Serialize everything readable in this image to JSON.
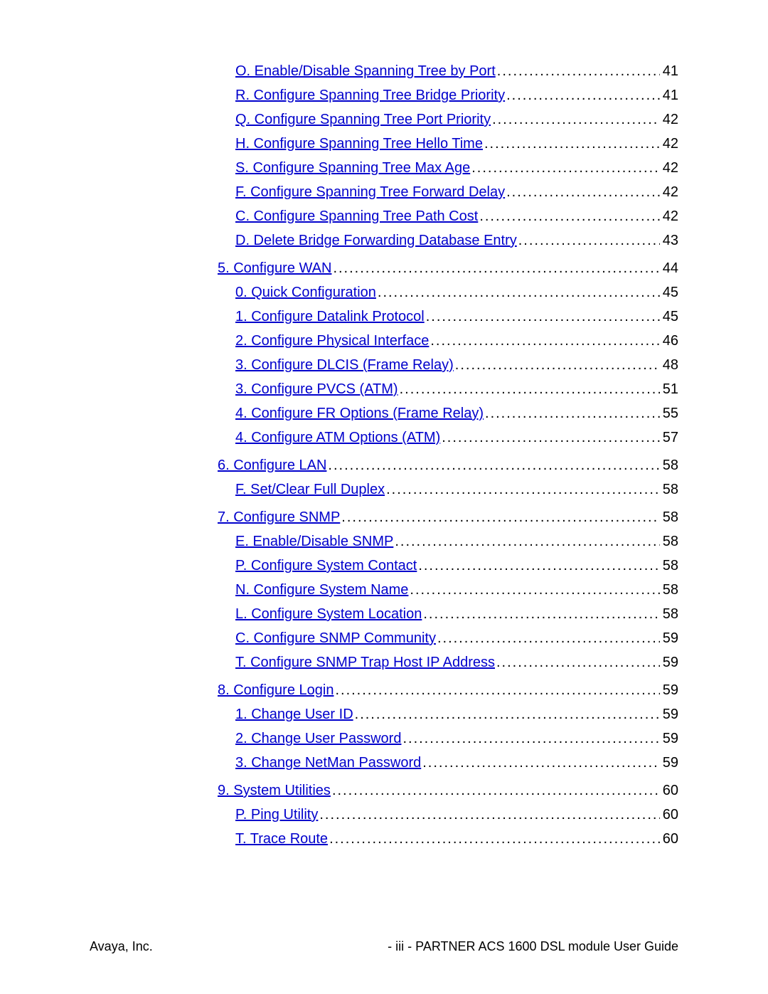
{
  "toc": [
    {
      "level": 2,
      "label": "O. Enable/Disable Spanning Tree by Port",
      "page": "41",
      "gap": false
    },
    {
      "level": 2,
      "label": "R. Configure Spanning Tree Bridge Priority",
      "page": "41",
      "gap": false
    },
    {
      "level": 2,
      "label": "Q. Configure Spanning Tree Port Priority",
      "page": "42",
      "gap": false
    },
    {
      "level": 2,
      "label": "H. Configure Spanning Tree Hello Time",
      "page": "42",
      "gap": false
    },
    {
      "level": 2,
      "label": "S. Configure Spanning Tree Max Age",
      "page": "42",
      "gap": false
    },
    {
      "level": 2,
      "label": "F. Configure Spanning Tree Forward Delay",
      "page": "42",
      "gap": false
    },
    {
      "level": 2,
      "label": "C. Configure Spanning Tree Path Cost",
      "page": "42",
      "gap": false
    },
    {
      "level": 2,
      "label": "D. Delete Bridge Forwarding Database Entry",
      "page": "43",
      "gap": false
    },
    {
      "level": 1,
      "label": "5. Configure WAN",
      "page": "44",
      "gap": true
    },
    {
      "level": 2,
      "label": "0. Quick Configuration",
      "page": "45",
      "gap": false
    },
    {
      "level": 2,
      "label": "1. Configure Datalink Protocol",
      "page": "45",
      "gap": false
    },
    {
      "level": 2,
      "label": "2. Configure Physical Interface",
      "page": "46",
      "gap": false
    },
    {
      "level": 2,
      "label": "3. Configure DLCIS (Frame Relay)",
      "page": "48",
      "gap": false
    },
    {
      "level": 2,
      "label": "3. Configure PVCS (ATM)",
      "page": "51",
      "gap": false
    },
    {
      "level": 2,
      "label": "4. Configure FR Options (Frame Relay)",
      "page": "55",
      "gap": false
    },
    {
      "level": 2,
      "label": "4. Configure ATM Options (ATM)",
      "page": "57",
      "gap": false
    },
    {
      "level": 1,
      "label": "6. Configure LAN",
      "page": "58",
      "gap": true
    },
    {
      "level": 2,
      "label": "F. Set/Clear Full Duplex",
      "page": "58",
      "gap": false
    },
    {
      "level": 1,
      "label": "7. Configure SNMP",
      "page": "58",
      "gap": true
    },
    {
      "level": 2,
      "label": "E. Enable/Disable SNMP",
      "page": "58",
      "gap": false
    },
    {
      "level": 2,
      "label": "P. Configure System Contact",
      "page": "58",
      "gap": false
    },
    {
      "level": 2,
      "label": "N. Configure System Name",
      "page": "58",
      "gap": false
    },
    {
      "level": 2,
      "label": "L. Configure System Location",
      "page": "58",
      "gap": false
    },
    {
      "level": 2,
      "label": "C. Configure SNMP Community",
      "page": "59",
      "gap": false
    },
    {
      "level": 2,
      "label": "T. Configure SNMP Trap Host IP Address",
      "page": "59",
      "gap": false
    },
    {
      "level": 1,
      "label": "8. Configure Login",
      "page": "59",
      "gap": true
    },
    {
      "level": 2,
      "label": "1. Change User ID",
      "page": "59",
      "gap": false
    },
    {
      "level": 2,
      "label": "2. Change User Password",
      "page": "59",
      "gap": false
    },
    {
      "level": 2,
      "label": "3. Change NetMan Password",
      "page": "59",
      "gap": false
    },
    {
      "level": 1,
      "label": "9. System Utilities",
      "page": "60",
      "gap": true
    },
    {
      "level": 2,
      "label": "P. Ping Utility",
      "page": "60",
      "gap": false
    },
    {
      "level": 2,
      "label": "T. Trace Route",
      "page": "60",
      "gap": false
    }
  ],
  "footer": {
    "left": "Avaya, Inc.",
    "right": "- iii -   PARTNER ACS 1600 DSL module User Guide"
  }
}
